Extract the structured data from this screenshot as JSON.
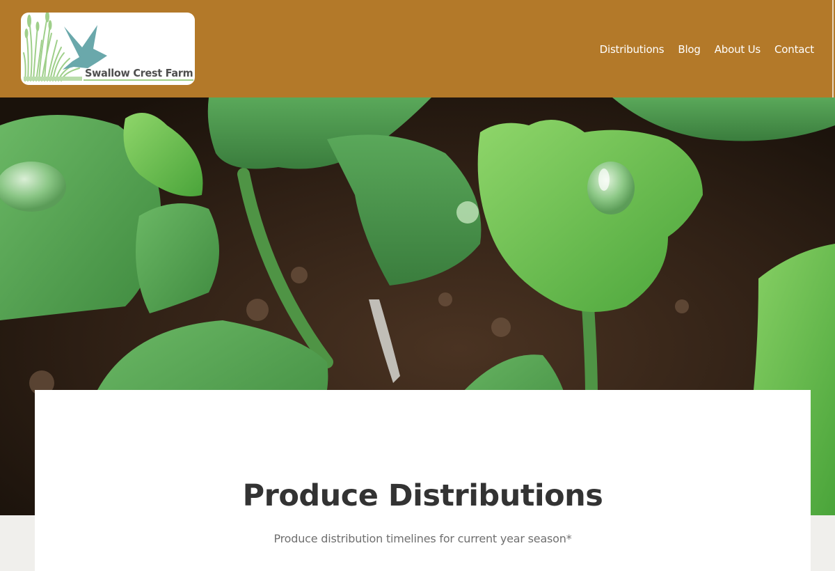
{
  "site": {
    "logo_text": "Swallow Crest Farm",
    "header_color": "#b37929"
  },
  "nav": {
    "items": [
      {
        "label": "Distributions"
      },
      {
        "label": "Blog"
      },
      {
        "label": "About Us"
      },
      {
        "label": "Contact"
      }
    ]
  },
  "hero": {
    "image": "kale-seedlings-with-water-droplets"
  },
  "main": {
    "title": "Produce Distributions",
    "subtitle": "Produce distribution timelines for current year season*"
  }
}
